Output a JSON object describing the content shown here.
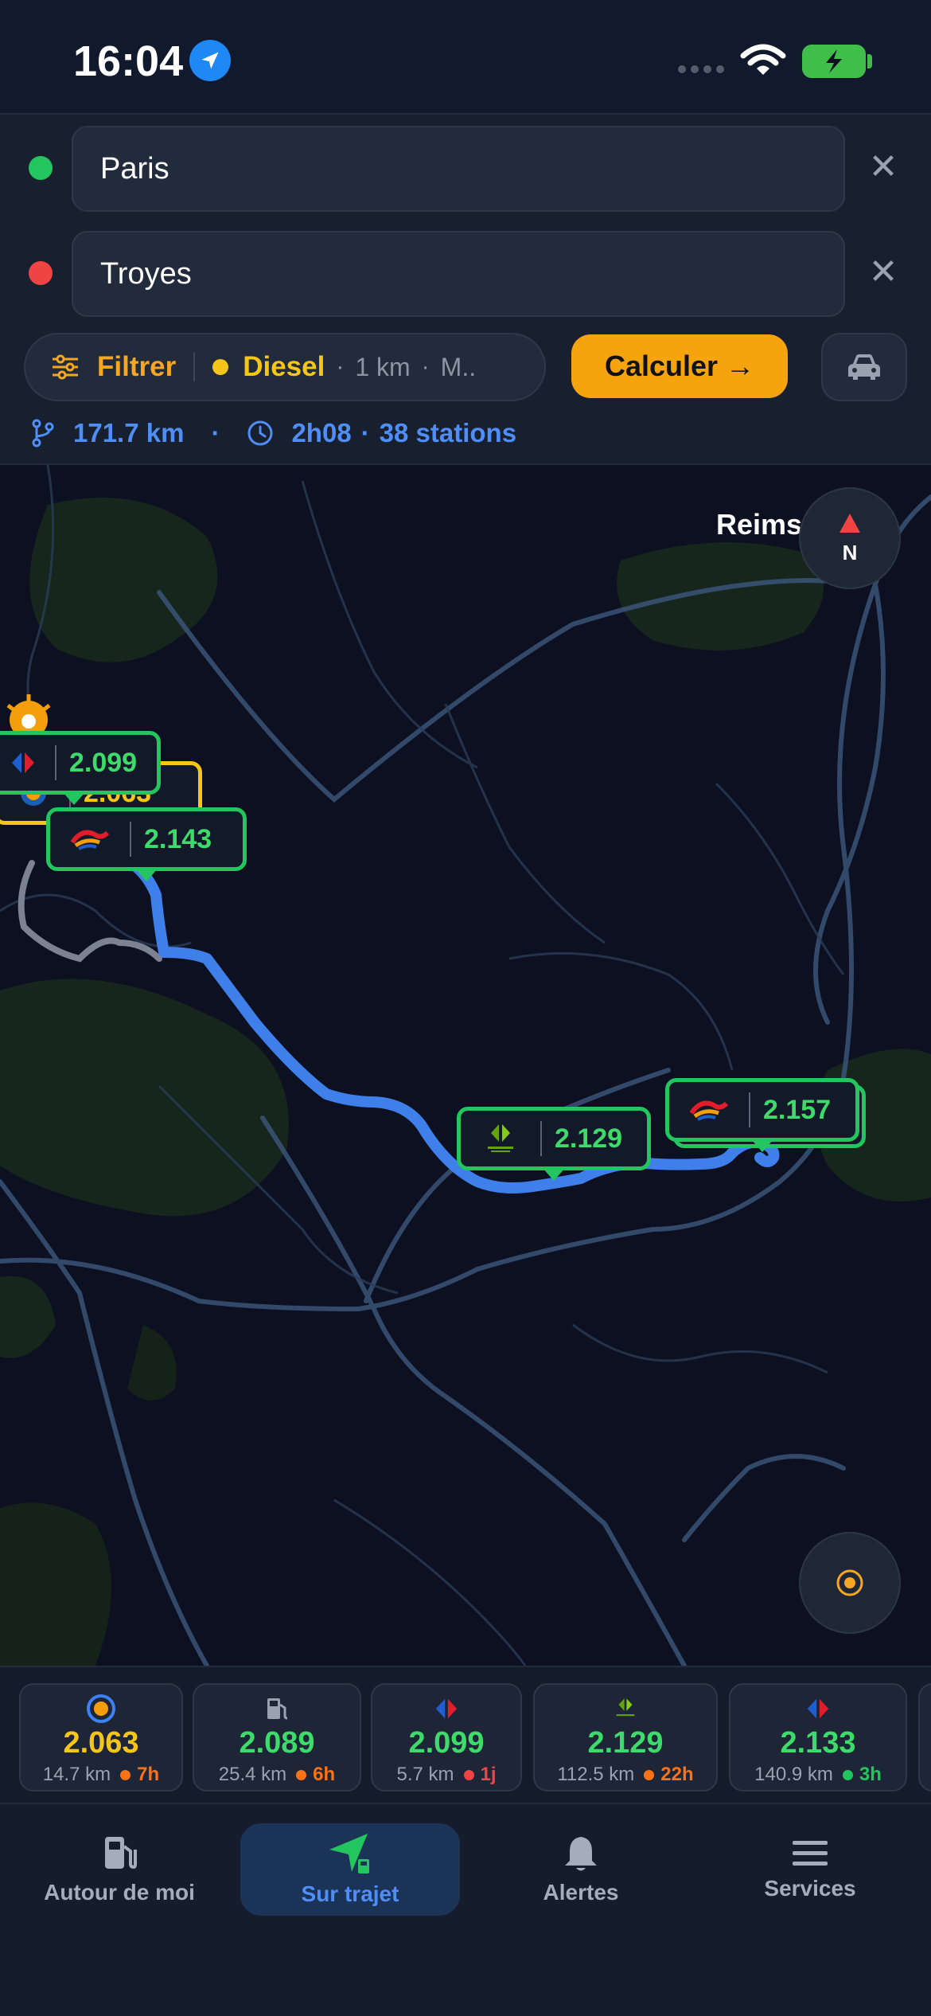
{
  "status": {
    "time": "16:04"
  },
  "route": {
    "origin": "Paris",
    "destination": "Troyes"
  },
  "filters": {
    "filter_label": "Filtrer",
    "fuel": "Diesel",
    "radius": "1 km",
    "more": "M.."
  },
  "actions": {
    "calculate": "Calculer →"
  },
  "summary": {
    "distance": "171.7 km",
    "duration": "2h08",
    "stations": "38 stations"
  },
  "map": {
    "city": "Reims",
    "compass": "N",
    "markers": [
      {
        "brand": "Carrefour",
        "price": "2.099",
        "color": "green"
      },
      {
        "brand": "Leclerc",
        "price": "2.063",
        "color": "yellow"
      },
      {
        "brand": "TotalEnergies",
        "price": "2.143",
        "color": "green"
      },
      {
        "brand": "Carrefour Contact",
        "price": "2.129",
        "color": "green"
      },
      {
        "brand": "TotalEnergies",
        "price": "2.157",
        "color": "green"
      }
    ]
  },
  "cards": [
    {
      "brand": "Leclerc",
      "price": "2.063",
      "distance": "14.7 km",
      "age": "7h",
      "dot": "#f97316",
      "price_color": "yellow"
    },
    {
      "brand": "Station",
      "price": "2.089",
      "distance": "25.4 km",
      "age": "6h",
      "dot": "#f97316",
      "price_color": "green"
    },
    {
      "brand": "Carrefour",
      "price": "2.099",
      "distance": "5.7 km",
      "age": "1j",
      "dot": "#ef4444",
      "price_color": "green"
    },
    {
      "brand": "Carrefour Contact",
      "price": "2.129",
      "distance": "112.5 km",
      "age": "22h",
      "dot": "#f97316",
      "price_color": "green"
    },
    {
      "brand": "Carrefour",
      "price": "2.133",
      "distance": "140.9 km",
      "age": "3h",
      "dot": "#22c55e",
      "price_color": "green"
    }
  ],
  "tabs": [
    {
      "label": "Autour de moi",
      "icon": "fuel-pump-icon"
    },
    {
      "label": "Sur trajet",
      "icon": "navigation-icon"
    },
    {
      "label": "Alertes",
      "icon": "bell-icon"
    },
    {
      "label": "Services",
      "icon": "menu-icon"
    }
  ]
}
